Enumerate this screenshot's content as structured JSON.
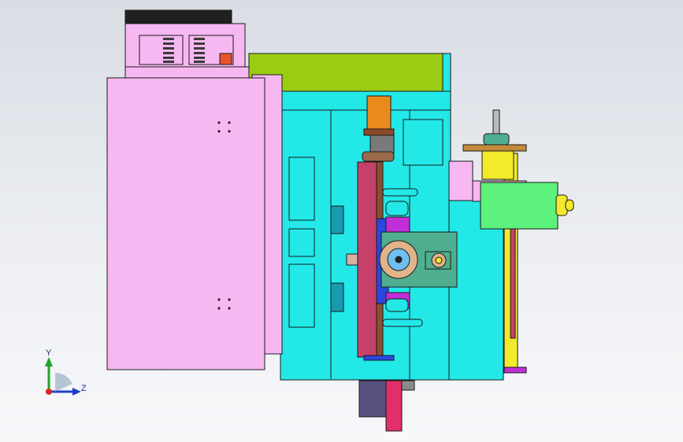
{
  "viewport": {
    "background_top": "#d9dde4",
    "background_bottom": "#f7f8fa"
  },
  "triad": {
    "y_label": "Y",
    "z_label": "Z",
    "x_axis_color": "#d9261c",
    "y_axis_color": "#1fa32a",
    "z_axis_color": "#1d3fc8"
  },
  "colors": {
    "housing_pink": "#f7b8f2",
    "frame_cyan": "#22e8e8",
    "cover_olive": "#9ccc12",
    "motor_green": "#5cf27c",
    "slide_red": "#c6416a",
    "carriage_blue": "#2a48e0",
    "plate_teal": "#4fae8f",
    "rail_yellow": "#f4ea2c",
    "motor_orange": "#e88a1c",
    "gear_tan": "#e0b48a",
    "block_purple": "#5a5080",
    "outline": "#1a1a1a"
  }
}
